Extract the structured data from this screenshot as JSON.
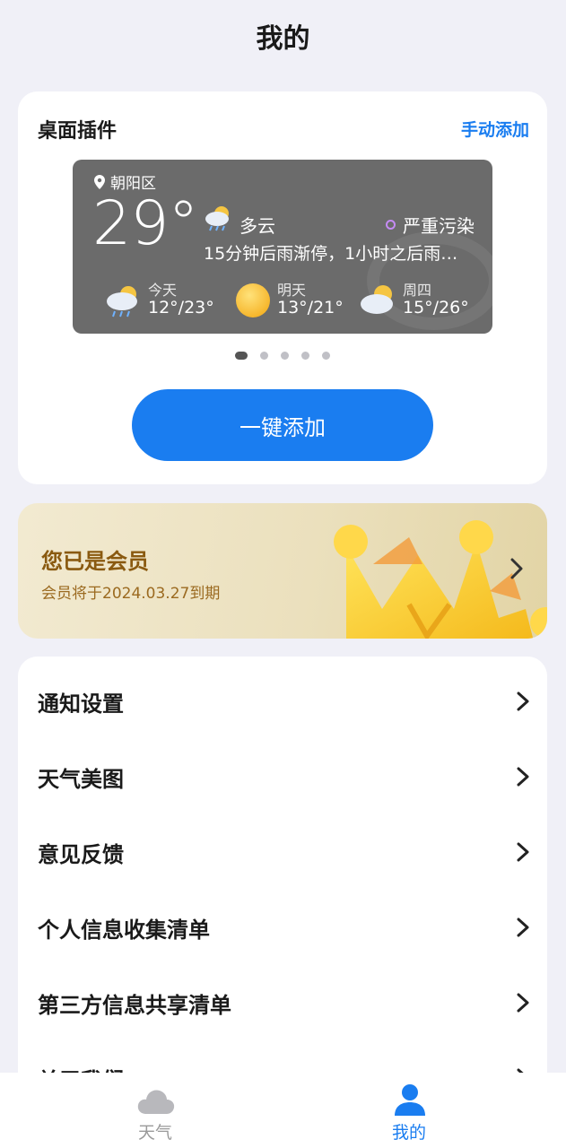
{
  "header": {
    "title": "我的"
  },
  "widget": {
    "title": "桌面插件",
    "manual_add": "手动添加",
    "preview": {
      "location": "朝阳区",
      "temperature": "29°",
      "condition": "多云",
      "air_quality": "严重污染",
      "rain_note": "15分钟后雨渐停，1小时之后雨…",
      "forecast": [
        {
          "day": "今天",
          "range": "12°/23°",
          "icon": "cloud-rain-icon"
        },
        {
          "day": "明天",
          "range": "13°/21°",
          "icon": "sun-icon"
        },
        {
          "day": "周四",
          "range": "15°/26°",
          "icon": "cloud-sun-icon"
        }
      ]
    },
    "page_count": 5,
    "active_page": 1,
    "add_button": "一键添加"
  },
  "membership": {
    "title": "您已是会员",
    "subtitle": "会员将于2024.03.27到期"
  },
  "menu": {
    "items": [
      {
        "label": "通知设置"
      },
      {
        "label": "天气美图"
      },
      {
        "label": "意见反馈"
      },
      {
        "label": "个人信息收集清单"
      },
      {
        "label": "第三方信息共享清单"
      },
      {
        "label": "关于我们"
      }
    ]
  },
  "tabbar": {
    "tabs": [
      {
        "label": "天气",
        "icon": "cloud-icon",
        "active": false
      },
      {
        "label": "我的",
        "icon": "person-icon",
        "active": true
      }
    ]
  },
  "colors": {
    "accent": "#1a7df0",
    "member_text": "#8a5a10",
    "inactive_tab": "#9a9a9a"
  }
}
